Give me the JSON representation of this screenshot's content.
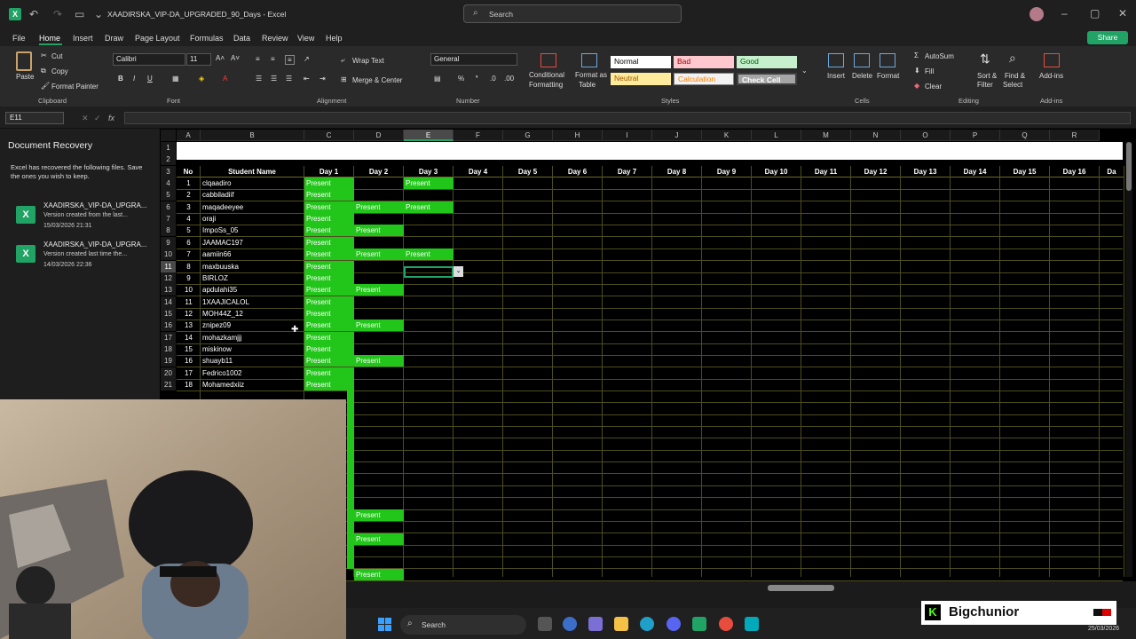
{
  "titlebar": {
    "filename": "XAADIRSKA_VIP-DA_UPGRADED_90_Days",
    "app": "Excel",
    "search_placeholder": "Search"
  },
  "menu": [
    "File",
    "Home",
    "Insert",
    "Draw",
    "Page Layout",
    "Formulas",
    "Data",
    "Review",
    "View",
    "Help"
  ],
  "share_label": "Share",
  "ribbon": {
    "clipboard": {
      "paste": "Paste",
      "cut": "Cut",
      "copy": "Copy",
      "format_painter": "Format Painter",
      "group": "Clipboard"
    },
    "font": {
      "name": "Calibri",
      "size": "11",
      "group": "Font"
    },
    "alignment": {
      "wrap": "Wrap Text",
      "merge": "Merge & Center",
      "group": "Alignment"
    },
    "number": {
      "format": "General",
      "group": "Number"
    },
    "styles": {
      "conditional": "Conditional",
      "formatting": "Formatting",
      "format_as": "Format as",
      "table": "Table",
      "normal": "Normal",
      "bad": "Bad",
      "good": "Good",
      "neutral": "Neutral",
      "calculation": "Calculation",
      "check": "Check Cell",
      "group": "Styles"
    },
    "cells": {
      "insert": "Insert",
      "delete": "Delete",
      "format": "Format",
      "group": "Cells"
    },
    "editing": {
      "autosum": "AutoSum",
      "fill": "Fill",
      "clear": "Clear",
      "sort": "Sort &",
      "filter": "Filter",
      "find": "Find &",
      "select": "Select",
      "group": "Editing"
    },
    "addins": {
      "label": "Add-ins",
      "group": "Add-ins"
    }
  },
  "namebox": "E11",
  "fx": "fx",
  "recovery": {
    "title": "Document Recovery",
    "desc": "Excel has recovered the following files.  Save the ones you wish to keep.",
    "files": [
      {
        "name": "XAADIRSKA_VIP-DA_UPGRA...",
        "desc": "Version created from the last...",
        "date": "15/03/2026 21:31"
      },
      {
        "name": "XAADIRSKA_VIP-DA_UPGRA...",
        "desc": "Version created last time the...",
        "date": "14/03/2026 22:36"
      }
    ]
  },
  "sheet": {
    "columns": [
      "A",
      "B",
      "C",
      "D",
      "E",
      "F",
      "G",
      "H",
      "I",
      "J",
      "K",
      "L",
      "M",
      "N",
      "O",
      "P",
      "Q",
      "R"
    ],
    "header": [
      "No",
      "Student Name",
      "Day 1",
      "Day 2",
      "Day 3",
      "Day 4",
      "Day 5",
      "Day 6",
      "Day 7",
      "Day 8",
      "Day 9",
      "Day 10",
      "Day 11",
      "Day 12",
      "Day 13",
      "Day 14",
      "Day 15",
      "Day 16",
      "Da"
    ],
    "rownums": [
      "1",
      "2",
      "3",
      "4",
      "5",
      "6",
      "7",
      "8",
      "9",
      "10",
      "11",
      "12",
      "13",
      "14",
      "15",
      "16",
      "17",
      "18",
      "19",
      "20",
      "21"
    ],
    "present": "Present",
    "students": [
      {
        "no": "1",
        "name": "clqaadiro",
        "d1": true,
        "d2": false,
        "d3": true
      },
      {
        "no": "2",
        "name": "cabbiladiif",
        "d1": true,
        "d2": false,
        "d3": false
      },
      {
        "no": "3",
        "name": "maqadeeyee",
        "d1": true,
        "d2": true,
        "d3": true
      },
      {
        "no": "4",
        "name": "oraji",
        "d1": true,
        "d2": false,
        "d3": false
      },
      {
        "no": "5",
        "name": "ImpoSs_05",
        "d1": true,
        "d2": true,
        "d3": false
      },
      {
        "no": "6",
        "name": "JAAMAC197",
        "d1": true,
        "d2": false,
        "d3": false
      },
      {
        "no": "7",
        "name": "aamiin66",
        "d1": true,
        "d2": true,
        "d3": true
      },
      {
        "no": "8",
        "name": "maxbuuska",
        "d1": true,
        "d2": false,
        "d3": false
      },
      {
        "no": "9",
        "name": "BIRLOZ",
        "d1": true,
        "d2": false,
        "d3": false
      },
      {
        "no": "10",
        "name": "apdulahi35",
        "d1": true,
        "d2": true,
        "d3": false
      },
      {
        "no": "11",
        "name": "1XAAJICALOL",
        "d1": true,
        "d2": false,
        "d3": false
      },
      {
        "no": "12",
        "name": "MOH44Z_12",
        "d1": true,
        "d2": false,
        "d3": false
      },
      {
        "no": "13",
        "name": "znipez09",
        "d1": true,
        "d2": true,
        "d3": false
      },
      {
        "no": "14",
        "name": "mohazkamjjj",
        "d1": true,
        "d2": false,
        "d3": false
      },
      {
        "no": "15",
        "name": "miskinow",
        "d1": true,
        "d2": false,
        "d3": false
      },
      {
        "no": "16",
        "name": "shuayb11",
        "d1": true,
        "d2": true,
        "d3": false
      },
      {
        "no": "17",
        "name": "Fedrico1002",
        "d1": true,
        "d2": false,
        "d3": false
      },
      {
        "no": "18",
        "name": "Mohamedxiiz",
        "d1": true,
        "d2": false,
        "d3": false
      }
    ]
  },
  "taskbar": {
    "search": "Search",
    "date": "25/03/2026"
  },
  "overlay": {
    "streamer": "Bigchunior"
  },
  "colors": {
    "present": "#22c51a",
    "grid": "#6b6b2a",
    "accent": "#21a366"
  }
}
